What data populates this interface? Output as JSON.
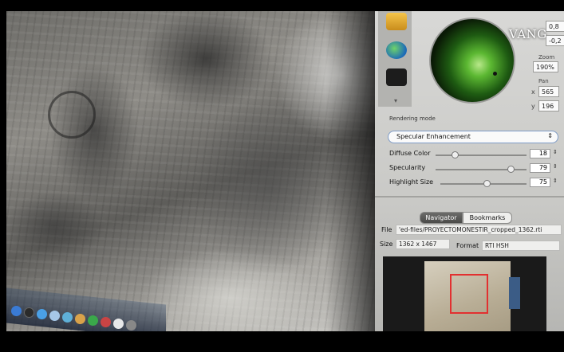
{
  "brand": {
    "logo_text": "VANG"
  },
  "panel": {
    "tools": [
      "folder-icon",
      "globe-icon",
      "camera-icon"
    ],
    "light": {
      "x_value": "0,8",
      "y_value": "-0,2"
    },
    "zoom": {
      "label": "Zoom",
      "value": "190%"
    },
    "pan": {
      "label": "Pan",
      "x_label": "x",
      "x_value": "565",
      "y_label": "y",
      "y_value": "196"
    },
    "rendering": {
      "section_label": "Rendering mode",
      "selected_mode": "Specular Enhancement",
      "sliders": [
        {
          "label": "Diffuse Color",
          "value": "18",
          "level": 0.2
        },
        {
          "label": "Specularity",
          "value": "79",
          "level": 0.79
        },
        {
          "label": "Highlight Size",
          "value": "75",
          "level": 0.52
        }
      ]
    },
    "tabs": {
      "active": "Navigator",
      "inactive": "Bookmarks"
    },
    "file_info": {
      "file_label": "File",
      "file_value": "'ed-files/PROYECTOMONESTIR_cropped_1362.rti",
      "size_label": "Size",
      "size_value": "1362 x 1467",
      "format_label": "Format",
      "format_value": "RTI HSH"
    }
  },
  "colors": {
    "accent_select_border": "#7d9bc7",
    "thumbnail_highlight": "#e23030",
    "sphere_light": "#5cb832"
  }
}
